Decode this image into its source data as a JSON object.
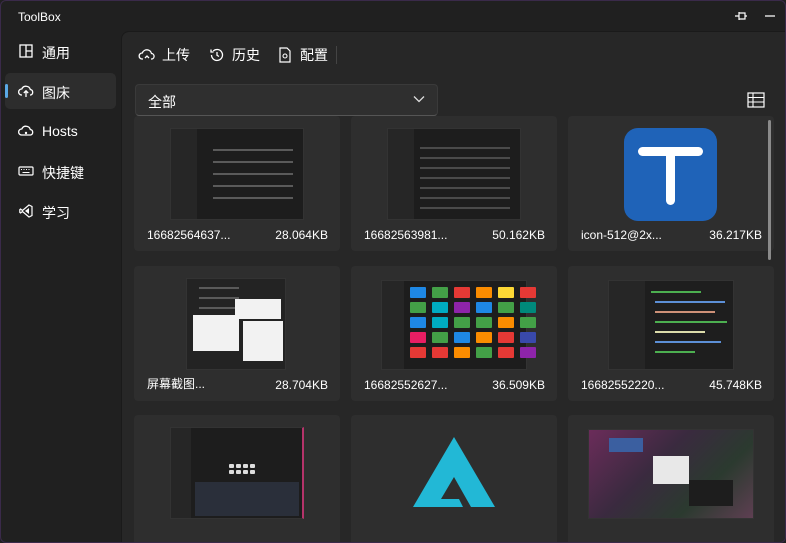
{
  "window": {
    "title": "ToolBox"
  },
  "sidebar": {
    "items": [
      {
        "label": "通用",
        "icon": "layout-icon"
      },
      {
        "label": "图床",
        "icon": "cloud-upload-icon",
        "active": true
      },
      {
        "label": "Hosts",
        "icon": "cloud-icon"
      },
      {
        "label": "快捷键",
        "icon": "keyboard-icon"
      },
      {
        "label": "学习",
        "icon": "vscode-icon"
      }
    ]
  },
  "toolbar": {
    "upload_label": "上传",
    "history_label": "历史",
    "config_label": "配置"
  },
  "filter": {
    "selected": "全部"
  },
  "accent_color": "#5aa9e6",
  "images": [
    {
      "name": "16682564637...",
      "size": "28.064KB"
    },
    {
      "name": "16682563981...",
      "size": "50.162KB"
    },
    {
      "name": "icon-512@2x...",
      "size": "36.217KB"
    },
    {
      "name": "屏幕截图...",
      "size": "28.704KB"
    },
    {
      "name": "16682552627...",
      "size": "36.509KB"
    },
    {
      "name": "16682552220...",
      "size": "45.748KB"
    },
    {
      "name": "",
      "size": ""
    },
    {
      "name": "",
      "size": ""
    },
    {
      "name": "",
      "size": ""
    }
  ]
}
